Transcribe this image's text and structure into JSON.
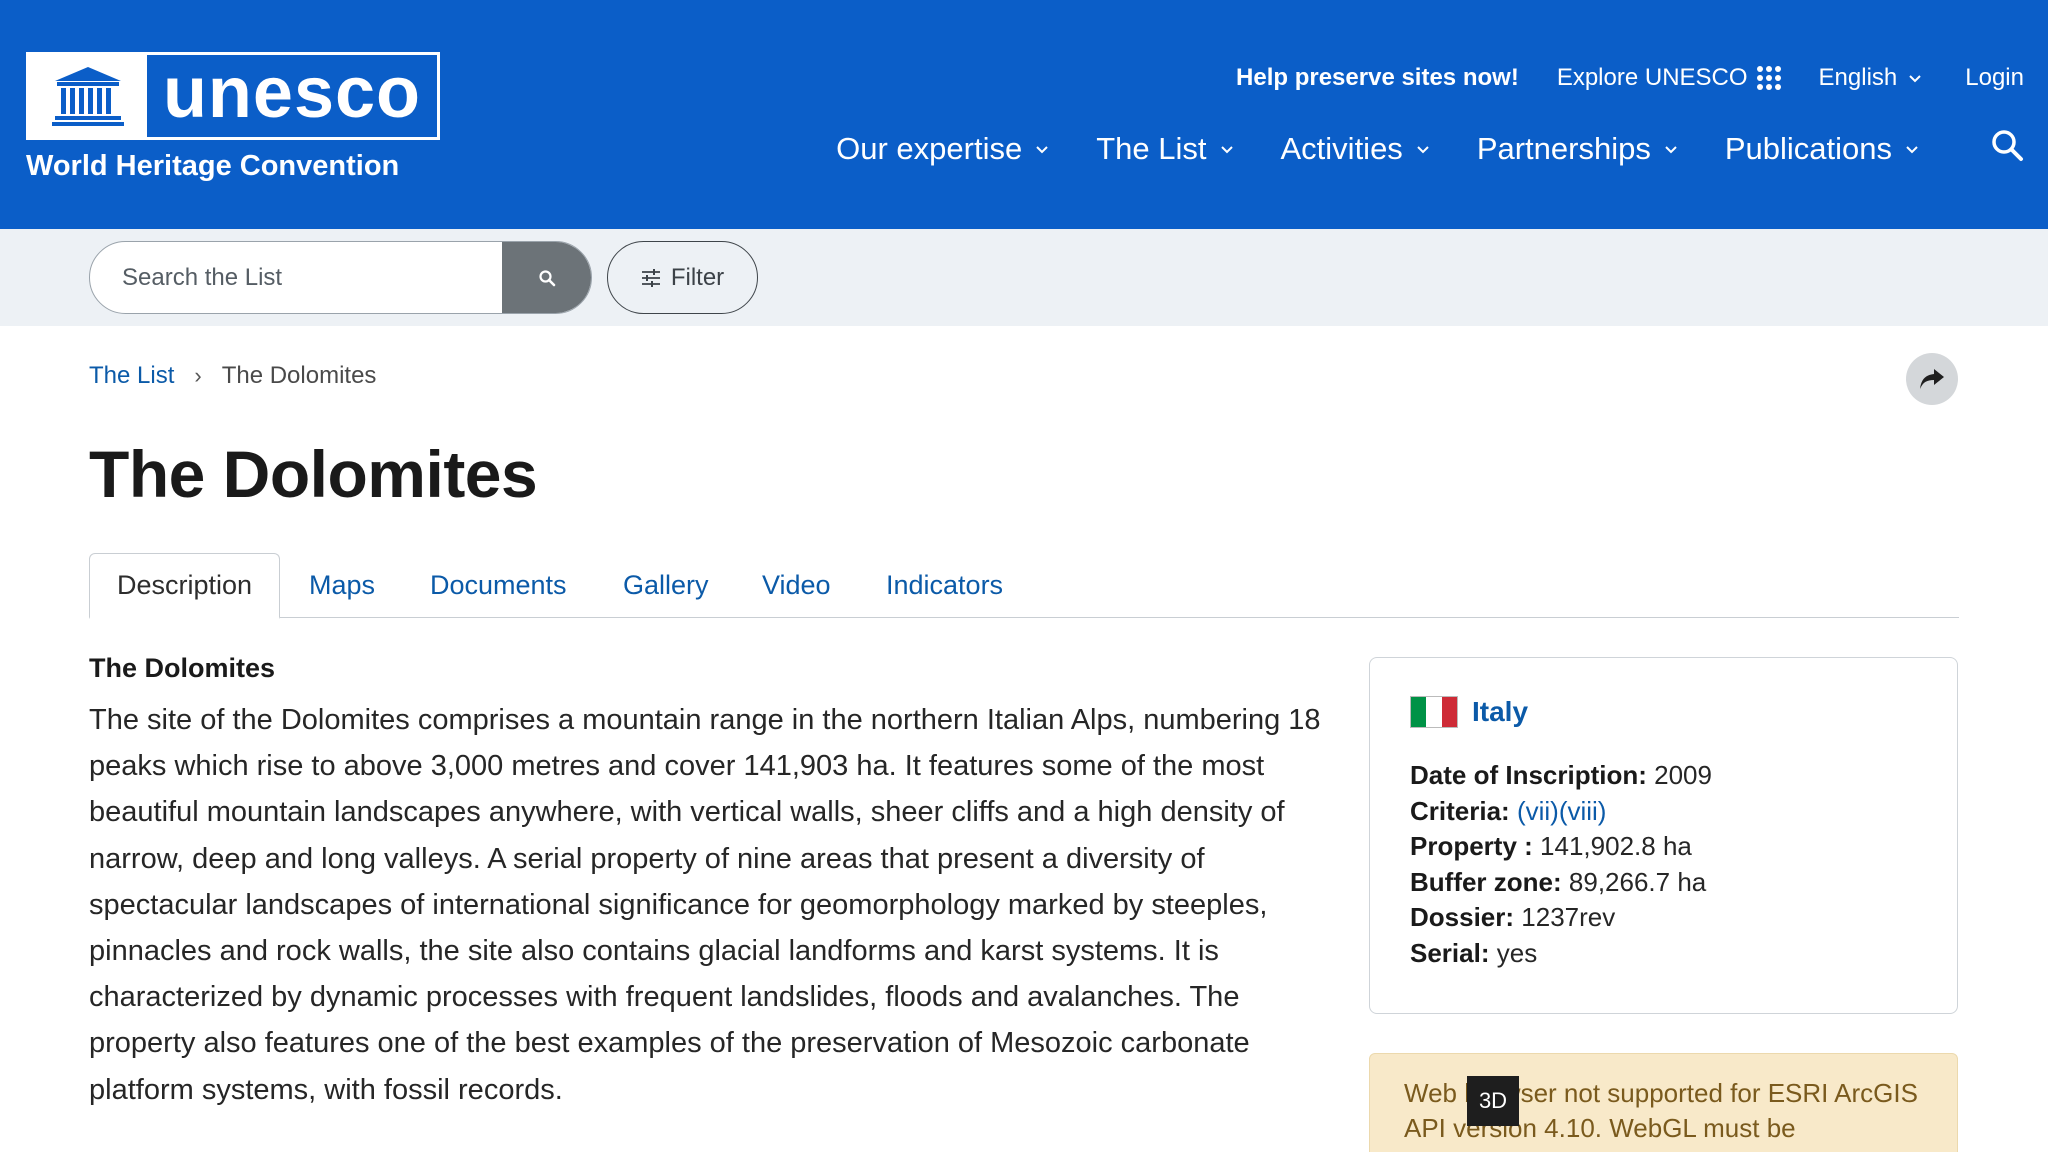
{
  "header": {
    "logo_word": "unesco",
    "logo_temple": "UNESCO",
    "logo_subtitle": "World Heritage Convention",
    "help_link": "Help preserve sites now!",
    "explore_label": "Explore UNESCO",
    "language": "English",
    "login": "Login",
    "nav": [
      "Our expertise",
      "The List",
      "Activities",
      "Partnerships",
      "Publications"
    ],
    "brand_color": "#0b5ec8"
  },
  "search": {
    "placeholder": "Search the List",
    "filter_label": "Filter"
  },
  "breadcrumb": {
    "root": "The List",
    "separator": "›",
    "current": "The Dolomites"
  },
  "page": {
    "title": "The Dolomites"
  },
  "tabs": [
    "Description",
    "Maps",
    "Documents",
    "Gallery",
    "Video",
    "Indicators"
  ],
  "active_tab": "Description",
  "description": {
    "heading": "The Dolomites",
    "body": "The site of the Dolomites comprises a mountain range in the northern Italian Alps, numbering 18 peaks which rise to above 3,000 metres and cover 141,903 ha. It features some of the most beautiful mountain landscapes anywhere, with vertical walls, sheer cliffs and a high density of narrow, deep and long valleys. A serial property of nine areas that present a diversity of spectacular landscapes of international significance for geomorphology marked by steeples, pinnacles and rock walls, the site also contains glacial landforms and karst systems. It is characterized by dynamic processes with frequent landslides, floods and avalanches. The property also features one of the best examples of the preservation of Mesozoic carbonate platform systems, with fossil records."
  },
  "info": {
    "country": "Italy",
    "flag_colors": [
      "#009246",
      "#ffffff",
      "#ce2b37"
    ],
    "inscription_label": "Date of Inscription:",
    "inscription_value": "2009",
    "criteria_label": "Criteria:",
    "criteria_values": [
      "(vii)",
      "(viii)"
    ],
    "property_label": "Property :",
    "property_value": "141,902.8 ha",
    "buffer_label": "Buffer zone:",
    "buffer_value": "89,266.7 ha",
    "dossier_label": "Dossier:",
    "dossier_value": "1237rev",
    "serial_label": "Serial:",
    "serial_value": "yes"
  },
  "map_notice": {
    "text": "Web browser not supported for ESRI ArcGIS API version 4.10. WebGL must be",
    "badge": "3D"
  },
  "icons": {
    "search": "search-icon",
    "filter": "sliders-icon",
    "share": "share-arrow-icon",
    "apps": "grid-dots-icon",
    "dropdown": "chevron-down-icon"
  }
}
